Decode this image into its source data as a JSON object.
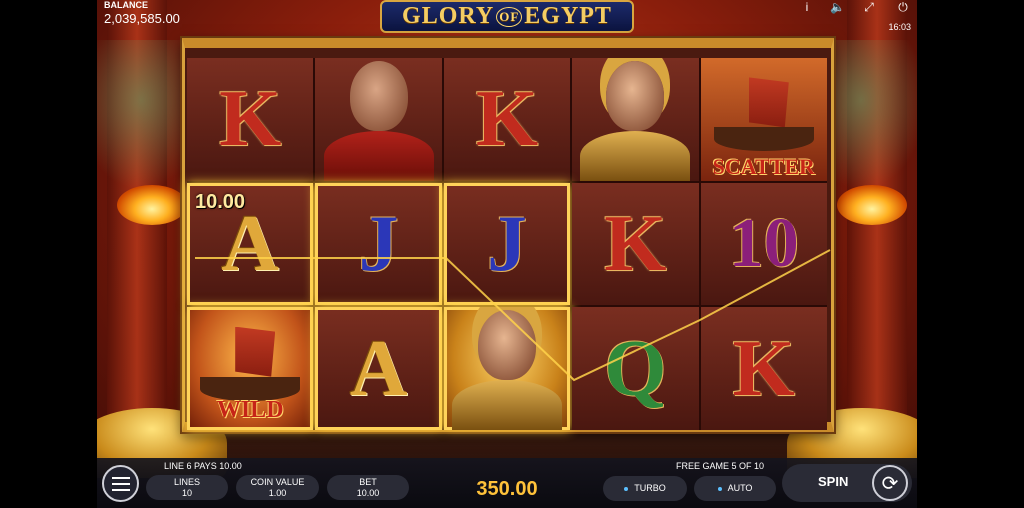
{
  "game": {
    "title_left": "GLORY",
    "title_of": "OF",
    "title_right": "EGYPT"
  },
  "hud": {
    "balance_label": "BALANCE",
    "balance_value": "2,039,585.00",
    "clock": "16:03",
    "icons": [
      "info-icon",
      "sound-icon",
      "fullscreen-icon",
      "power-icon"
    ]
  },
  "reels": {
    "rows": [
      [
        {
          "symbol": "K",
          "kind": "letter",
          "win": false
        },
        {
          "symbol": "caesar",
          "kind": "portrait",
          "win": false
        },
        {
          "symbol": "K",
          "kind": "letter",
          "win": false
        },
        {
          "symbol": "cleopatra",
          "kind": "portrait",
          "win": false
        },
        {
          "symbol": "scatter",
          "kind": "ship",
          "label": "SCATTER",
          "win": false
        }
      ],
      [
        {
          "symbol": "A",
          "kind": "letter",
          "win": true,
          "win_amount": "10.00"
        },
        {
          "symbol": "J",
          "kind": "letter",
          "win": true
        },
        {
          "symbol": "J",
          "kind": "letter",
          "win": true
        },
        {
          "symbol": "K",
          "kind": "letter",
          "win": false
        },
        {
          "symbol": "10",
          "kind": "letter",
          "win": false
        }
      ],
      [
        {
          "symbol": "wild",
          "kind": "ship",
          "label": "WILD",
          "win": true
        },
        {
          "symbol": "A",
          "kind": "letter",
          "win": true
        },
        {
          "symbol": "cleopatra",
          "kind": "portrait-gold",
          "win": true
        },
        {
          "symbol": "Q",
          "kind": "letter",
          "win": false
        },
        {
          "symbol": "K",
          "kind": "letter",
          "win": false
        }
      ]
    ]
  },
  "status": {
    "line_pays": "LINE 6 PAYS 10.00",
    "free_game": "FREE GAME 5 OF 10"
  },
  "controls": {
    "lines_label": "LINES",
    "lines_value": "10",
    "coin_value_label": "COIN VALUE",
    "coin_value": "1.00",
    "bet_label": "BET",
    "bet_value": "10.00",
    "total_win": "350.00",
    "turbo_label": "TURBO",
    "auto_label": "AUTO",
    "spin_label": "SPIN"
  },
  "colors": {
    "accent_gold": "#ffc23a",
    "frame_gold": "#d8a23c",
    "payline": "#ffd24a"
  }
}
